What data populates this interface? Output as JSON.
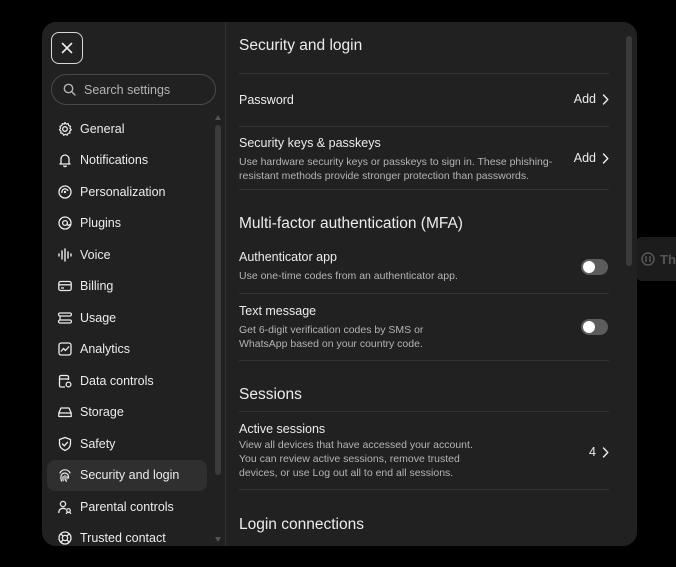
{
  "background": {
    "chip_text": "Th"
  },
  "sidebar": {
    "search_placeholder": "Search settings",
    "items": [
      {
        "label": "General",
        "icon": "gear-icon"
      },
      {
        "label": "Notifications",
        "icon": "bell-icon"
      },
      {
        "label": "Personalization",
        "icon": "personalization-icon"
      },
      {
        "label": "Plugins",
        "icon": "plugins-icon"
      },
      {
        "label": "Voice",
        "icon": "voice-waveform-icon"
      },
      {
        "label": "Billing",
        "icon": "credit-card-icon"
      },
      {
        "label": "Usage",
        "icon": "usage-icon"
      },
      {
        "label": "Analytics",
        "icon": "analytics-icon"
      },
      {
        "label": "Data controls",
        "icon": "database-icon"
      },
      {
        "label": "Storage",
        "icon": "storage-icon"
      },
      {
        "label": "Safety",
        "icon": "shield-check-icon"
      },
      {
        "label": "Security and login",
        "icon": "fingerprint-icon",
        "active": true
      },
      {
        "label": "Parental controls",
        "icon": "parental-icon"
      },
      {
        "label": "Trusted contact",
        "icon": "lifebuoy-icon"
      }
    ]
  },
  "main": {
    "title": "Security and login",
    "password": {
      "label": "Password",
      "action": "Add"
    },
    "passkeys": {
      "label": "Security keys & passkeys",
      "desc_line1": "Use hardware security keys or passkeys to sign in. These phishing-",
      "desc_line2": "resistant methods provide stronger protection than passwords.",
      "action": "Add"
    },
    "mfa": {
      "title": "Multi-factor authentication (MFA)",
      "authenticator": {
        "label": "Authenticator app",
        "desc": "Use one-time codes from an authenticator app.",
        "enabled": false
      },
      "sms": {
        "label": "Text message",
        "desc_line1": "Get 6-digit verification codes by SMS or",
        "desc_line2": "WhatsApp based on your country code.",
        "enabled": false
      }
    },
    "sessions": {
      "title": "Sessions",
      "active": {
        "label": "Active sessions",
        "desc_line1": "View all devices that have accessed your account.",
        "desc_line2": "You can review active sessions, remove trusted",
        "desc_line3": "devices, or use Log out all to end all sessions.",
        "count": "4"
      }
    },
    "login_connections": {
      "title": "Login connections"
    }
  },
  "colors": {
    "modal_bg": "#212121",
    "page_bg": "#000000",
    "active_item_bg": "#2f2f2f",
    "toggle_off": "#5c5c5c"
  }
}
